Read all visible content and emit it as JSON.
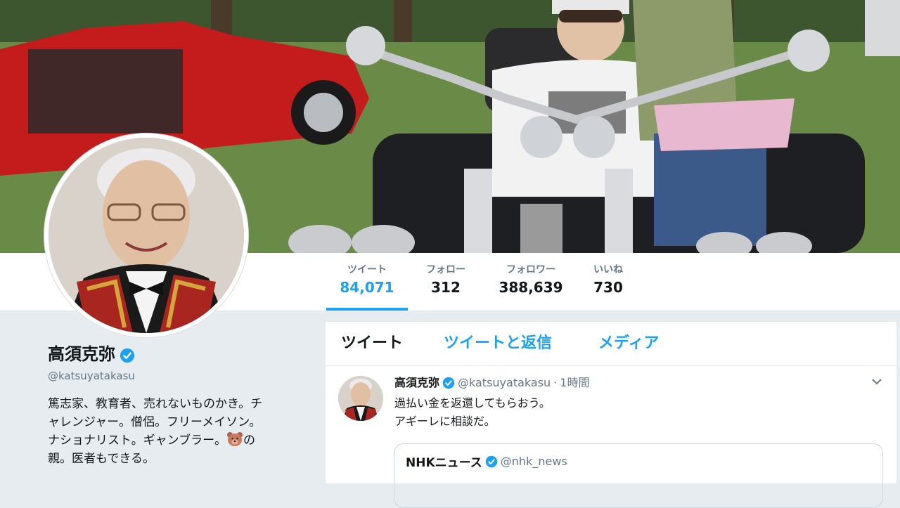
{
  "stats": [
    {
      "label": "ツイート",
      "value": "84,071"
    },
    {
      "label": "フォロー",
      "value": "312"
    },
    {
      "label": "フォロワー",
      "value": "388,639"
    },
    {
      "label": "いいね",
      "value": "730"
    }
  ],
  "profile": {
    "name": "高須克弥",
    "handle": "@katsuyatakasu",
    "bio_line1": "篤志家、教育者、売れないものかき。チ",
    "bio_line2": "ャレンジャー。僧侶。フリーメイソン。",
    "bio_line3a": "ナショナリスト。ギャンブラー。",
    "bio_line3b": "の",
    "bio_line4": "親。医者もできる。"
  },
  "tabs": [
    "ツイート",
    "ツイートと返信",
    "メディア"
  ],
  "tweet": {
    "name": "高須克弥",
    "handle": "@katsuyatakasu",
    "sep": "·",
    "time": "1時間",
    "line1": "過払い金を返還してもらおう。",
    "line2": "アギーレに相談だ。"
  },
  "quoted": {
    "name": "NHKニュース",
    "handle": "@nhk_news"
  },
  "icons": {
    "verified": "verified-badge-icon",
    "caret": "chevron-down-icon",
    "bear": "bear-face-emoji-icon"
  },
  "colors": {
    "accent": "#1da1f2",
    "text": "#14171a",
    "muted": "#657786",
    "bg": "#e6ecf0"
  }
}
